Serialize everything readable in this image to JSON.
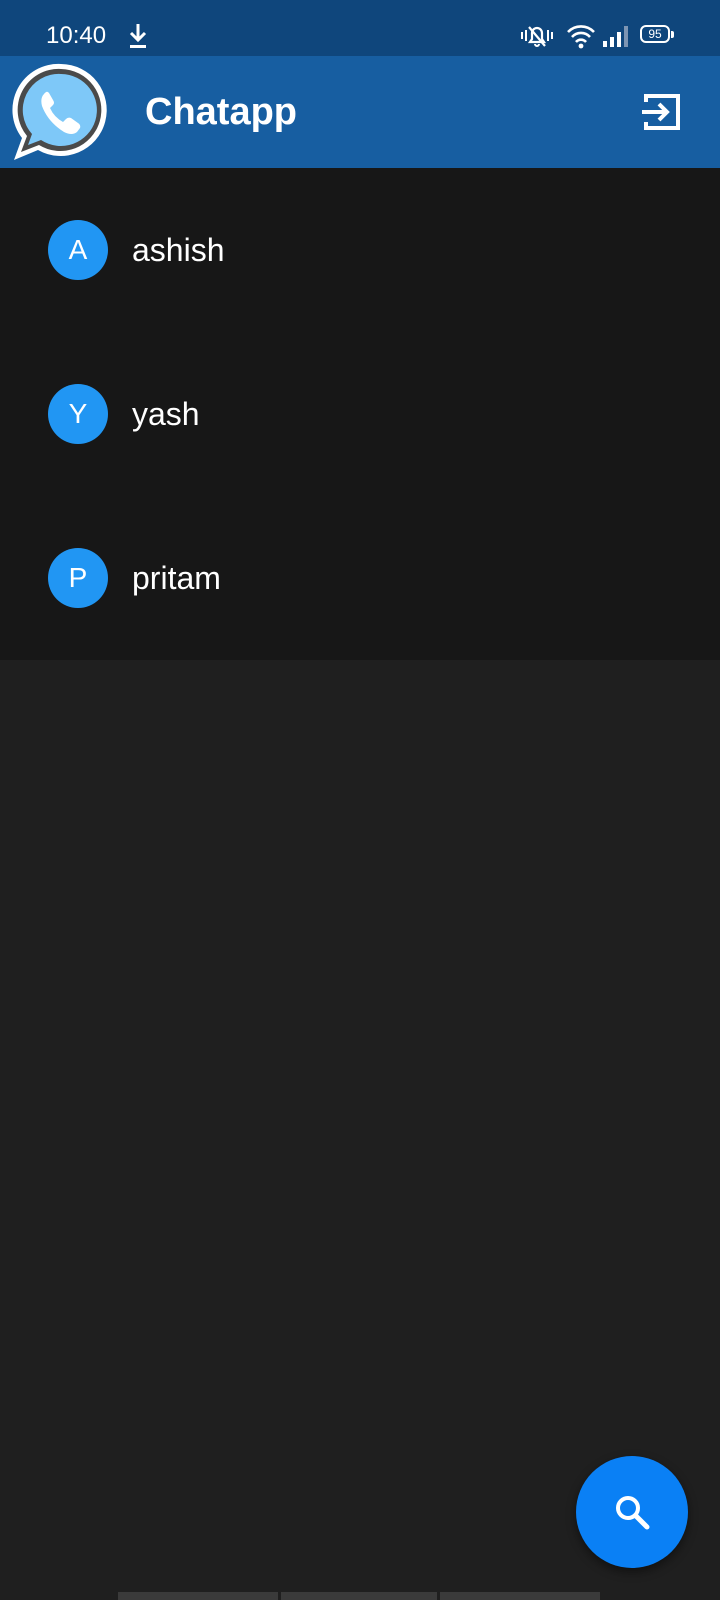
{
  "status_bar": {
    "time": "10:40",
    "battery_level": "95",
    "icons": [
      "download-icon",
      "mute-bell-icon",
      "wifi-icon",
      "signal-icon",
      "battery-icon"
    ]
  },
  "app_bar": {
    "title": "Chatapp",
    "logo_icon": "phone-chat-logo-icon",
    "action_icon": "logout-icon"
  },
  "contacts": [
    {
      "initial": "A",
      "name": "ashish"
    },
    {
      "initial": "Y",
      "name": "yash"
    },
    {
      "initial": "P",
      "name": "pritam"
    }
  ],
  "fab": {
    "icon": "search-icon"
  },
  "colors": {
    "status_bar": "#0f467c",
    "app_bar": "#175ea1",
    "list_background": "#171717",
    "page_background": "#1f1f1f",
    "avatar": "#2196f3",
    "fab": "#0a80f5"
  }
}
